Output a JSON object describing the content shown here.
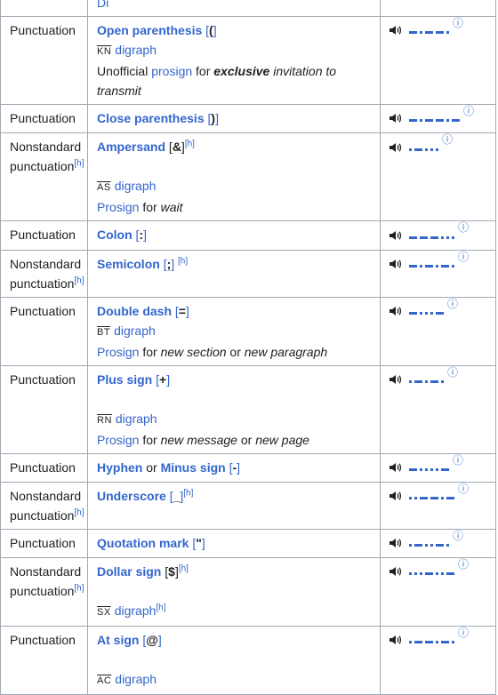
{
  "rows": [
    {
      "category": "",
      "symbol_html": "<span class='lnk'>Di</span>",
      "morse": "",
      "partial_top": true
    },
    {
      "category": "Punctuation",
      "lines": [
        {
          "html": "<span class='name'>Open parenthesis</span> <span class='glyph'>[<b>(</b>]</span>"
        },
        {
          "html": "<span class='ov'>KN</span><a>digraph</a>"
        },
        {
          "html": "Unofficial <a>prosign</a> for <b><i>exclusive</i></b> <i>invitation to transmit</i>"
        }
      ],
      "morse": "−·−−·"
    },
    {
      "category": "Punctuation",
      "lines": [
        {
          "html": "<span class='name'>Close parenthesis</span> <span class='glyph'>[<b>)</b>]</span>"
        }
      ],
      "morse": "−·−−·−"
    },
    {
      "category": "Nonstandard punctuation",
      "category_sup": "[h]",
      "lines": [
        {
          "html": "<span class='name'>Ampersand</span> [<b>&amp;</b>]<sup>[h]</sup>"
        },
        {
          "html": "",
          "blank": true
        },
        {
          "html": "<span class='ov'>AS</span><a>digraph</a>"
        },
        {
          "html": "<a>Prosign</a> for <i>wait</i>"
        }
      ],
      "morse": "·−···"
    },
    {
      "category": "Punctuation",
      "lines": [
        {
          "html": "<span class='name'>Colon</span> <span class='glyph'>[<b>:</b>]</span>"
        }
      ],
      "morse": "−−−···"
    },
    {
      "category": "Nonstandard punctuation",
      "category_sup": "[h]",
      "lines": [
        {
          "html": "<span class='name'>Semicolon</span> <span class='glyph'>[<b>;</b>]</span> <sup>[h]</sup>"
        }
      ],
      "morse": "−·−·−·"
    },
    {
      "category": "Punctuation",
      "lines": [
        {
          "html": "<span class='name'>Double dash</span> <span class='glyph'>[<b>=</b>]</span>"
        },
        {
          "html": "<span class='ov'>BT</span><a>digraph</a>"
        },
        {
          "html": "<a>Prosign</a> for <i>new section</i> or <i>new paragraph</i>"
        }
      ],
      "morse": "−···−"
    },
    {
      "category": "Punctuation",
      "lines": [
        {
          "html": "<span class='name'>Plus sign</span> <span class='glyph'>[<b>+</b>]</span>"
        },
        {
          "html": "",
          "blank": true
        },
        {
          "html": "<span class='ov'>RN</span><a>digraph</a>"
        },
        {
          "html": "<a>Prosign</a> for <i>new message</i> or <i>new page</i>"
        }
      ],
      "morse": "·−·−·"
    },
    {
      "category": "Punctuation",
      "lines": [
        {
          "html": "<span class='name'>Hyphen</span> or <span class='name'>Minus sign</span> <span class='glyph'>[<b>-</b>]</span>"
        }
      ],
      "morse": "−····−"
    },
    {
      "category": "Nonstandard punctuation",
      "category_sup": "[h]",
      "lines": [
        {
          "html": "<span class='name'>Underscore</span> <span class='glyph'>[<b>_</b>]</span><sup>[h]</sup>"
        }
      ],
      "morse": "··−−·−"
    },
    {
      "category": "Punctuation",
      "lines": [
        {
          "html": "<span class='name'>Quotation mark</span> <span class='glyph'>[<b>\"</b>]</span>"
        }
      ],
      "morse": "·−··−·"
    },
    {
      "category": "Nonstandard punctuation",
      "category_sup": "[h]",
      "lines": [
        {
          "html": "<span class='name'>Dollar sign</span> [<b>$</b>]<sup>[h]</sup>"
        },
        {
          "html": "",
          "blank": true
        },
        {
          "html": "<span class='ov'>SX</span><a>digraph</a><sup>[h]</sup>"
        }
      ],
      "morse": "···−··−"
    },
    {
      "category": "Punctuation",
      "lines": [
        {
          "html": "<span class='name'>At sign</span> <span class='glyph'>[<b>@</b>]</span>"
        },
        {
          "html": "",
          "blank": true
        },
        {
          "html": "<span class='ov'>AC</span><a>digraph</a>"
        }
      ],
      "morse": "·−−·−·"
    }
  ],
  "info_glyph": "ⓘ",
  "colors": {
    "link": "#3366cc",
    "border": "#a2a9b1",
    "text": "#202122"
  }
}
